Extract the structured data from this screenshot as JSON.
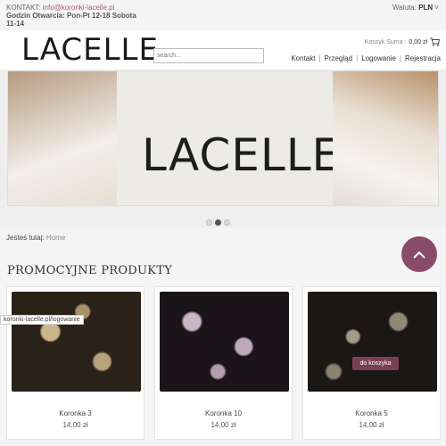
{
  "topbar": {
    "contact_label": "KONTAKT:",
    "contact_email": "info@koronki-lacelle.pl",
    "hours": "Godzin Otwarcia: Pon-Pt 12-18 Sobota 11-14",
    "currency_label": "Waluta:",
    "currency_value": "PLN"
  },
  "header": {
    "logo": "LACELLE",
    "search_placeholder": "search...",
    "cart_label": "Koszyk Suma :",
    "cart_value": "0,00 zł",
    "nav": [
      "Kontakt",
      "Przegląd",
      "Logowanie",
      "Rejestracja"
    ]
  },
  "banner": {
    "text": "LACELLE",
    "slides": 3,
    "active_slide": 2
  },
  "breadcrumb": {
    "label": "Jesteś tutaj:",
    "home": "Home"
  },
  "section": {
    "title": "PROMOCYJNE PRODUKTY"
  },
  "products": [
    {
      "name": "Koronka 3",
      "price": "14,00 zł"
    },
    {
      "name": "Koronka 10",
      "price": "14,00 zł"
    },
    {
      "name": "Koronka 5",
      "price": "14,00 zł",
      "hover_button": "do koszyka"
    }
  ],
  "status_bar": {
    "url": "koronki-lacelle.pl/logowanie"
  },
  "colors": {
    "accent": "#8a4a6a",
    "link": "#a06080"
  }
}
